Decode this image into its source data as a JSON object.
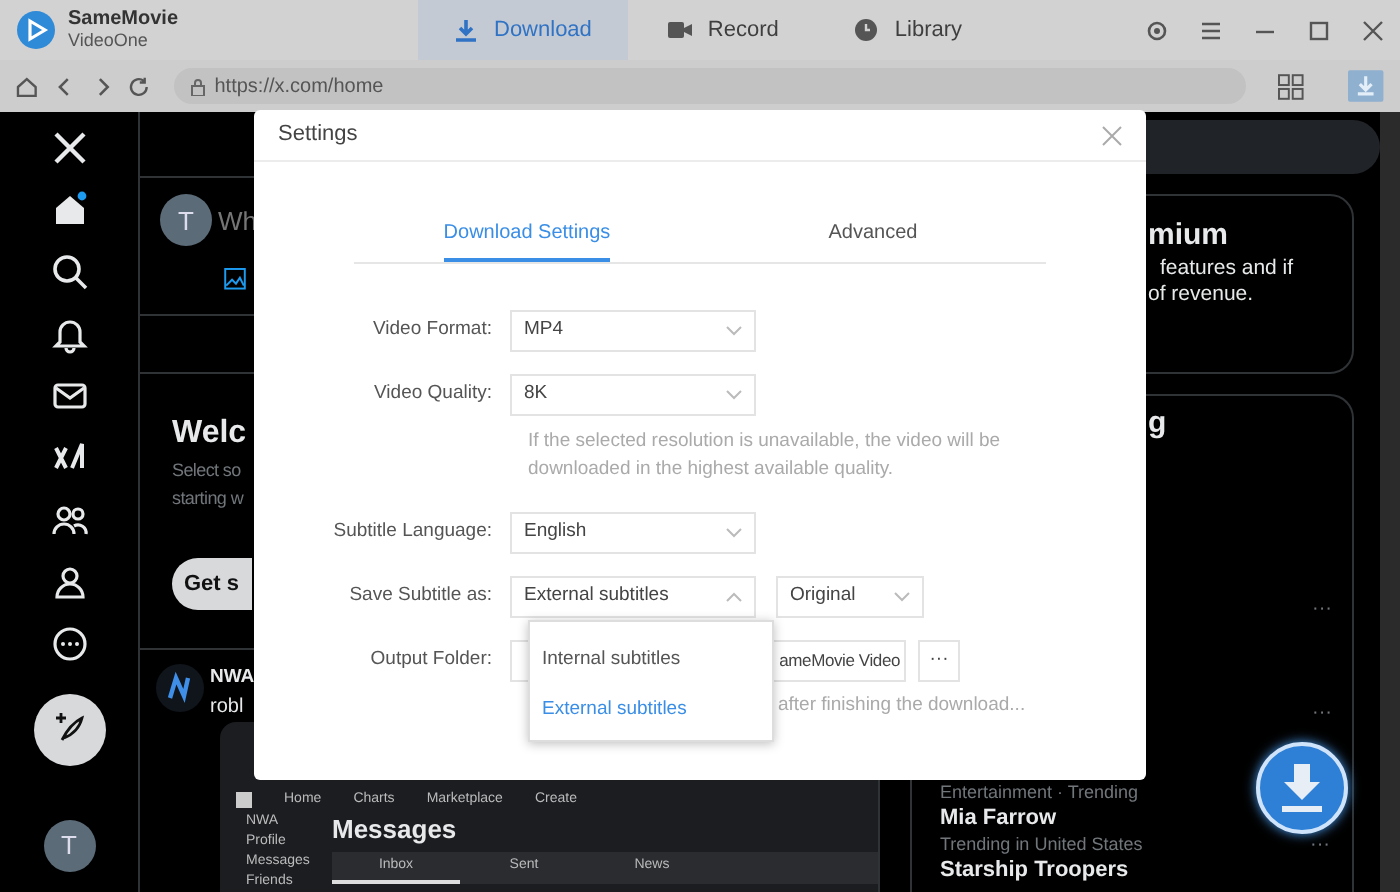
{
  "app": {
    "name": "SameMovie",
    "subtitle": "VideoOne"
  },
  "nav_tabs": [
    {
      "label": "Download",
      "selected": true,
      "kind": "download"
    },
    {
      "label": "Record",
      "selected": false,
      "kind": "record"
    },
    {
      "label": "Library",
      "selected": false,
      "kind": "library"
    }
  ],
  "address_bar": {
    "url": "https://x.com/home"
  },
  "x_page": {
    "sidebar_avatar": "T",
    "composer": {
      "avatar": "T",
      "placeholder": "Wh"
    },
    "welcome": {
      "title": "Welc",
      "lines": [
        "Select so",
        "starting w"
      ],
      "button": "Get s"
    },
    "post": {
      "author": "NWA",
      "text": "robl",
      "screenshot": {
        "menu": [
          "Home",
          "Charts",
          "Marketplace",
          "Create"
        ],
        "sidebar": [
          "NWA",
          "Profile",
          "Messages",
          "Friends"
        ],
        "heading": "Messages",
        "tabs": [
          {
            "label": "Inbox",
            "selected": true
          },
          {
            "label": "Sent",
            "selected": false
          },
          {
            "label": "News",
            "selected": false
          }
        ]
      }
    },
    "premium": {
      "title": "mium",
      "lines": [
        "features and if",
        "of revenue."
      ]
    },
    "trending": {
      "title": "g",
      "more_buttons": [
        "···",
        "···",
        "···"
      ],
      "items": [
        {
          "category": "Entertainment · Trending",
          "topic": "Mia Farrow"
        },
        {
          "category": "Trending in United States",
          "topic": "Starship Troopers"
        }
      ]
    }
  },
  "settings_dialog": {
    "title": "Settings",
    "tabs": [
      {
        "label": "Download Settings",
        "selected": true
      },
      {
        "label": "Advanced",
        "selected": false
      }
    ],
    "fields": [
      {
        "kind": "select",
        "label": "Video Format:",
        "value": "MP4",
        "expanded": false
      },
      {
        "kind": "select",
        "label": "Video Quality:",
        "value": "8K",
        "expanded": false,
        "hint": "If the selected resolution is unavailable, the video will be downloaded in the highest available quality."
      },
      {
        "kind": "select",
        "label": "Subtitle Language:",
        "value": "English",
        "expanded": false
      },
      {
        "kind": "select",
        "label": "Save Subtitle as:",
        "value": "External subtitles",
        "expanded": true,
        "options": [
          {
            "label": "Internal subtitles",
            "selected": false
          },
          {
            "label": "External subtitles",
            "selected": true
          }
        ],
        "extra_value": "Original"
      },
      {
        "kind": "folder",
        "label": "Output Folder:",
        "value": "ameMovie Video",
        "browse": "···",
        "hint": "after finishing the download..."
      }
    ]
  }
}
